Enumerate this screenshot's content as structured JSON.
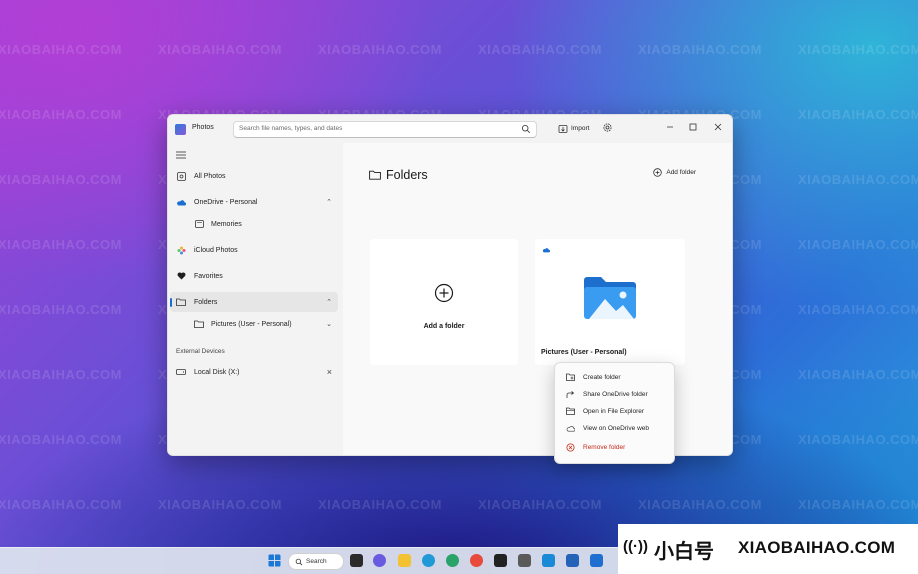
{
  "window": {
    "app_title": "Photos"
  },
  "search": {
    "placeholder": "Search file names, types, and dates"
  },
  "toolbar": {
    "import_label": "Import"
  },
  "sidebar": {
    "all_photos": "All Photos",
    "onedrive": "OneDrive - Personal",
    "memories": "Memories",
    "icloud": "iCloud Photos",
    "favorites": "Favorites",
    "folders": "Folders",
    "pictures_sub": "Pictures (User - Personal)",
    "external_header": "External Devices",
    "local_disk": "Local Disk (X:)"
  },
  "main": {
    "title": "Folders",
    "add_folder_button": "Add folder",
    "add_card_label": "Add a folder",
    "pictures_card_label": "Pictures (User - Personal)"
  },
  "context_menu": {
    "items": [
      {
        "label": "Create folder",
        "icon": "folder-add-icon"
      },
      {
        "label": "Share OneDrive folder",
        "icon": "share-icon"
      },
      {
        "label": "Open in File Explorer",
        "icon": "folder-open-icon"
      },
      {
        "label": "View on OneDrive web",
        "icon": "cloud-icon"
      },
      {
        "label": "Remove folder",
        "icon": "remove-icon",
        "danger": true
      }
    ]
  },
  "taskbar": {
    "search_label": "Search"
  },
  "branding": {
    "cn": "小白号",
    "en": "XIAOBAIHAO.COM"
  },
  "colors": {
    "accent": "#1a6fd1",
    "danger": "#c42b1c",
    "folder_blue": "#2f8be6"
  }
}
